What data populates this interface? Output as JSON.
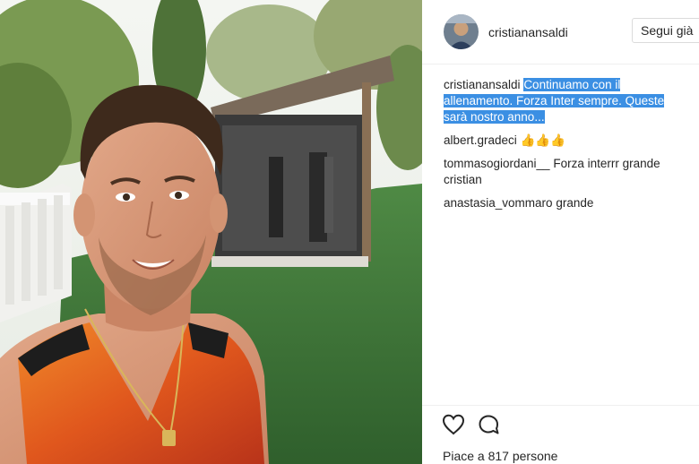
{
  "header": {
    "username": "cristianansaldi",
    "follow_label": "Segui già"
  },
  "caption": {
    "username": "cristianansaldi",
    "text": "Continuamo con il allenamento. Forza Inter sempre. Queste sarà nostro anno..."
  },
  "comments": [
    {
      "username": "albert.gradeci",
      "text": "👍👍👍"
    },
    {
      "username": "tommasogiordani__",
      "text": "Forza interrr grande cristian"
    },
    {
      "username": "anastasia_vommaro",
      "text": "grande"
    }
  ],
  "actions": {
    "like_icon": "heart-icon",
    "comment_icon": "comment-icon",
    "likes_text": "Piace a 817 persone"
  },
  "colors": {
    "selection": "#3b8fe3",
    "border": "#efefef",
    "text": "#262626"
  }
}
